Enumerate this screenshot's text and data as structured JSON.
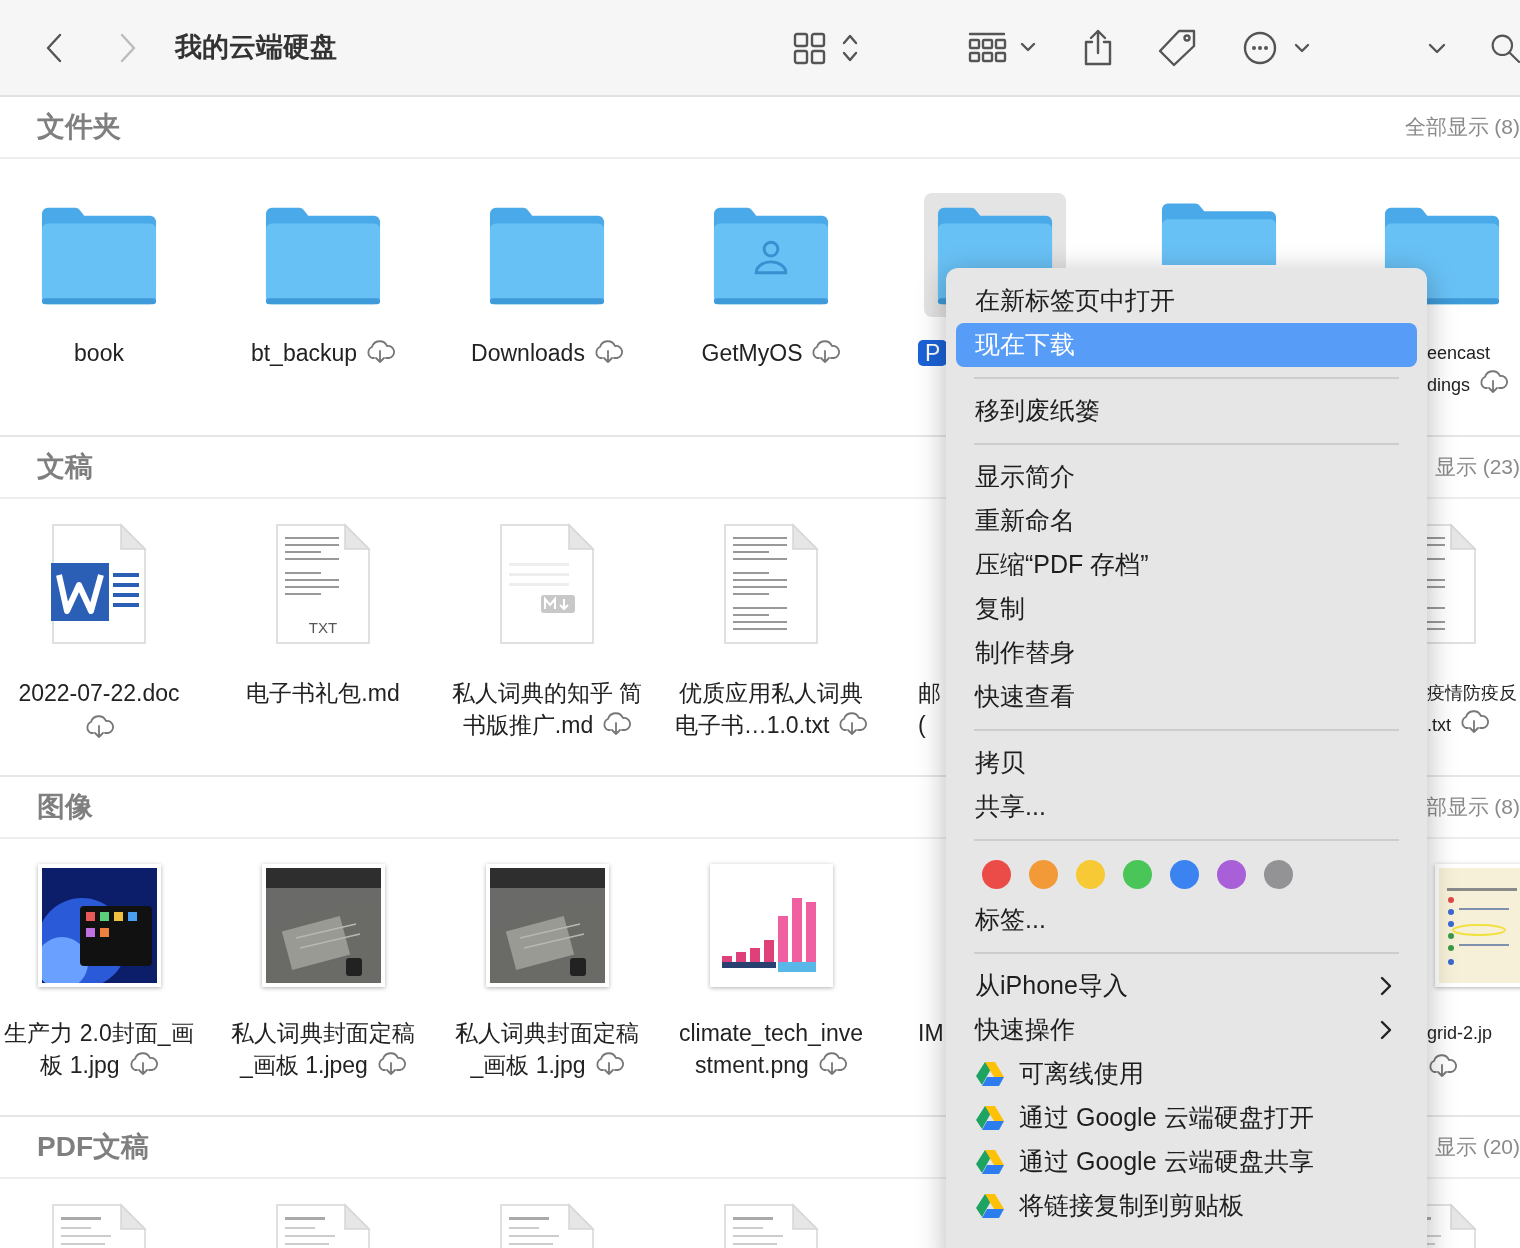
{
  "toolbar": {
    "back": {
      "disabled": false
    },
    "forward": {
      "disabled": true
    },
    "title": "我的云端硬盘"
  },
  "sections": [
    {
      "title": "文件夹",
      "show_all": "全部显示 (8)",
      "items": [
        {
          "kind": "folder",
          "lines": [
            "book"
          ],
          "selected": false
        },
        {
          "kind": "folder",
          "lines": [
            "bt_backup"
          ],
          "cloud": true,
          "selected": false
        },
        {
          "kind": "folder",
          "lines": [
            "Downloads"
          ],
          "cloud": true,
          "selected": false
        },
        {
          "kind": "shared-folder",
          "lines": [
            "GetMyOS"
          ],
          "cloud": true,
          "selected": false
        },
        {
          "kind": "folder",
          "lines": [
            "P"
          ],
          "selected": true
        },
        {
          "kind": "folder",
          "selected": false
        }
      ],
      "edge_item": {
        "kind": "folder",
        "lines": [
          "eencast",
          "dings"
        ],
        "cloud": true,
        "selected": false
      }
    },
    {
      "title": "文稿",
      "show_all": "显示 (23)",
      "items": [
        {
          "kind": "word",
          "lines": [
            "2022-07-22.doc"
          ],
          "cloud": true,
          "cloud_wrapped": true,
          "selected": false
        },
        {
          "kind": "txt",
          "badge": "TXT",
          "lines": [
            "电子书礼包.md"
          ],
          "selected": false
        },
        {
          "kind": "md",
          "lines": [
            "私人词典的知乎 简",
            "书版推广.md"
          ],
          "cloud": true,
          "selected": false
        },
        {
          "kind": "textpage",
          "lines": [
            "优质应用私人词典",
            "电子书…1.0.txt"
          ],
          "cloud": true,
          "selected": false
        },
        {
          "lines": [
            "邮",
            "("
          ],
          "selected": false
        }
      ],
      "edge_item": {
        "kind": "textpage",
        "lines": [
          "疫情防疫反",
          ".txt"
        ],
        "cloud": true,
        "selected": false
      }
    },
    {
      "title": "图像",
      "show_all": "部显示 (8)",
      "items": [
        {
          "kind": "picture",
          "lines": [
            "生产力 2.0封面_画",
            "板 1.jpg"
          ],
          "cloud": true,
          "selected": false
        },
        {
          "kind": "picture",
          "lines": [
            "私人词典封面定稿",
            "_画板 1.jpeg"
          ],
          "cloud": true,
          "selected": false
        },
        {
          "kind": "picture",
          "lines": [
            "私人词典封面定稿",
            "_画板 1.jpg"
          ],
          "cloud": true,
          "selected": false
        },
        {
          "kind": "picture",
          "lines": [
            "climate_tech_inve",
            "stment.png"
          ],
          "cloud": true,
          "selected": false
        },
        {
          "lines": [
            "IM"
          ],
          "selected": false
        }
      ],
      "edge_item": {
        "kind": "picture",
        "lines": [
          "grid-2.jp"
        ],
        "cloud": true,
        "cloud_wrapped": true,
        "selected": false
      }
    },
    {
      "title": "PDF文稿",
      "show_all": "显示 (20)",
      "items": [
        {
          "kind": "pdfpage",
          "selected": false
        },
        {
          "kind": "pdfpage",
          "selected": false
        },
        {
          "kind": "pdfpage",
          "selected": false
        },
        {
          "kind": "pdfpage",
          "selected": false
        }
      ],
      "edge_item": {
        "kind": "pdfpage",
        "selected": false
      }
    }
  ],
  "context_menu": [
    {
      "kind": "item",
      "label": "在新标签页中打开",
      "selected": false
    },
    {
      "kind": "item",
      "label": "现在下载",
      "selected": true
    },
    {
      "kind": "separator"
    },
    {
      "kind": "item",
      "label": "移到废纸篓",
      "selected": false
    },
    {
      "kind": "separator"
    },
    {
      "kind": "item",
      "label": "显示简介",
      "selected": false
    },
    {
      "kind": "item",
      "label": "重新命名",
      "selected": false
    },
    {
      "kind": "item",
      "label": "压缩“PDF 存档”",
      "selected": false
    },
    {
      "kind": "item",
      "label": "复制",
      "selected": false
    },
    {
      "kind": "item",
      "label": "制作替身",
      "selected": false
    },
    {
      "kind": "item",
      "label": "快速查看",
      "selected": false
    },
    {
      "kind": "separator"
    },
    {
      "kind": "item",
      "label": "拷贝",
      "selected": false
    },
    {
      "kind": "item",
      "label": "共享...",
      "selected": false
    },
    {
      "kind": "separator"
    },
    {
      "kind": "tags",
      "colors": [
        {
          "color": "#ec4c47"
        },
        {
          "color": "#f19a37"
        },
        {
          "color": "#f7c934"
        },
        {
          "color": "#4ac658"
        },
        {
          "color": "#3a83f1"
        },
        {
          "color": "#a85fd7"
        },
        {
          "color": "#939396"
        }
      ]
    },
    {
      "kind": "item",
      "label": "标签...",
      "selected": false
    },
    {
      "kind": "separator"
    },
    {
      "kind": "submenu",
      "label": "从iPhone导入",
      "selected": false
    },
    {
      "kind": "submenu",
      "label": "快速操作",
      "selected": false
    },
    {
      "kind": "drive",
      "label": "可离线使用",
      "selected": false
    },
    {
      "kind": "drive",
      "label": "通过 Google 云端硬盘打开",
      "selected": false
    },
    {
      "kind": "drive",
      "label": "通过 Google 云端硬盘共享",
      "selected": false
    },
    {
      "kind": "drive",
      "label": "将链接复制到剪贴板",
      "selected": false
    }
  ]
}
